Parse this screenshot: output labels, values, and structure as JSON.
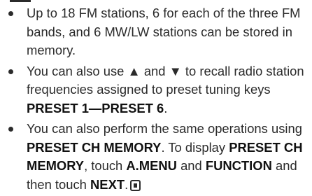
{
  "notes": [
    {
      "text": "Up to 18 FM stations, 6 for each of the three FM bands, and 6 MW/LW stations can be stored in memory."
    },
    {
      "p1": "You can also use ▲ and ▼ to recall radio station frequencies assigned to preset tuning keys ",
      "b1": "PRESET 1—PRESET 6",
      "p2": "."
    },
    {
      "p1": "You can also perform the same operations using ",
      "b1": "PRESET CH MEMORY",
      "p2": ". To display ",
      "b2": "PRESET CH MEMORY",
      "p3": ", touch ",
      "b3": "A.MENU",
      "p4": " and ",
      "b4": "FUNCTION",
      "p5": " and then touch ",
      "b5": "NEXT",
      "p6": "."
    }
  ],
  "icons": {
    "end_of_section": "end-of-section-icon"
  }
}
